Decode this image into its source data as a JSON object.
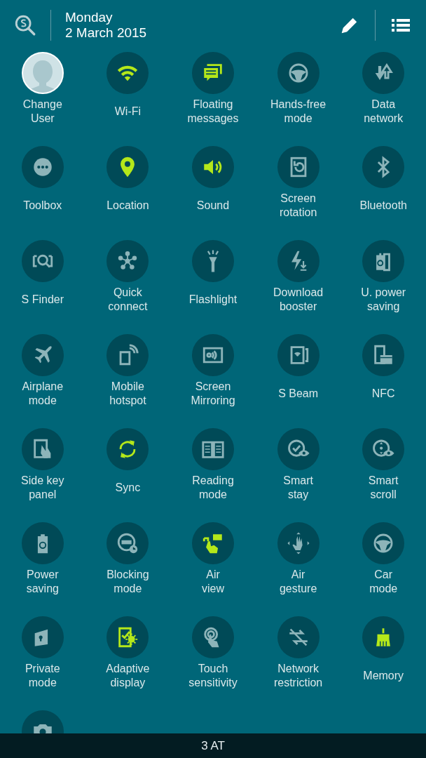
{
  "header": {
    "day": "Monday",
    "date": "2 March 2015"
  },
  "tiles": [
    {
      "kind": "avatar",
      "label": "Change\nUser",
      "on": false
    },
    {
      "kind": "toggle",
      "label": "Wi-Fi",
      "on": true
    },
    {
      "kind": "toggle",
      "label": "Floating\nmessages",
      "on": true
    },
    {
      "kind": "toggle",
      "label": "Hands-free\nmode",
      "on": false
    },
    {
      "kind": "toggle",
      "label": "Data\nnetwork",
      "on": false
    },
    {
      "kind": "toggle",
      "label": "Toolbox",
      "on": false
    },
    {
      "kind": "toggle",
      "label": "Location",
      "on": true
    },
    {
      "kind": "toggle",
      "label": "Sound",
      "on": true
    },
    {
      "kind": "toggle",
      "label": "Screen\nrotation",
      "on": false
    },
    {
      "kind": "toggle",
      "label": "Bluetooth",
      "on": false
    },
    {
      "kind": "toggle",
      "label": "S Finder",
      "on": false
    },
    {
      "kind": "toggle",
      "label": "Quick\nconnect",
      "on": false
    },
    {
      "kind": "toggle",
      "label": "Flashlight",
      "on": false
    },
    {
      "kind": "toggle",
      "label": "Download\nbooster",
      "on": false
    },
    {
      "kind": "toggle",
      "label": "U. power\nsaving",
      "on": false
    },
    {
      "kind": "toggle",
      "label": "Airplane\nmode",
      "on": false
    },
    {
      "kind": "toggle",
      "label": "Mobile\nhotspot",
      "on": false
    },
    {
      "kind": "toggle",
      "label": "Screen\nMirroring",
      "on": false
    },
    {
      "kind": "toggle",
      "label": "S Beam",
      "on": false
    },
    {
      "kind": "toggle",
      "label": "NFC",
      "on": false
    },
    {
      "kind": "toggle",
      "label": "Side key\npanel",
      "on": false
    },
    {
      "kind": "toggle",
      "label": "Sync",
      "on": true
    },
    {
      "kind": "toggle",
      "label": "Reading\nmode",
      "on": false
    },
    {
      "kind": "toggle",
      "label": "Smart\nstay",
      "on": false
    },
    {
      "kind": "toggle",
      "label": "Smart\nscroll",
      "on": false
    },
    {
      "kind": "toggle",
      "label": "Power\nsaving",
      "on": false
    },
    {
      "kind": "toggle",
      "label": "Blocking\nmode",
      "on": false
    },
    {
      "kind": "toggle",
      "label": "Air\nview",
      "on": true
    },
    {
      "kind": "toggle",
      "label": "Air\ngesture",
      "on": false
    },
    {
      "kind": "toggle",
      "label": "Car\nmode",
      "on": false
    },
    {
      "kind": "toggle",
      "label": "Private\nmode",
      "on": false
    },
    {
      "kind": "toggle",
      "label": "Adaptive\ndisplay",
      "on": true
    },
    {
      "kind": "toggle",
      "label": "Touch\nsensitivity",
      "on": false
    },
    {
      "kind": "toggle",
      "label": "Network\nrestriction",
      "on": false
    },
    {
      "kind": "toggle",
      "label": "Memory",
      "on": true
    },
    {
      "kind": "toggle",
      "on": false
    }
  ],
  "status_bar": {
    "carrier": "3 AT"
  }
}
